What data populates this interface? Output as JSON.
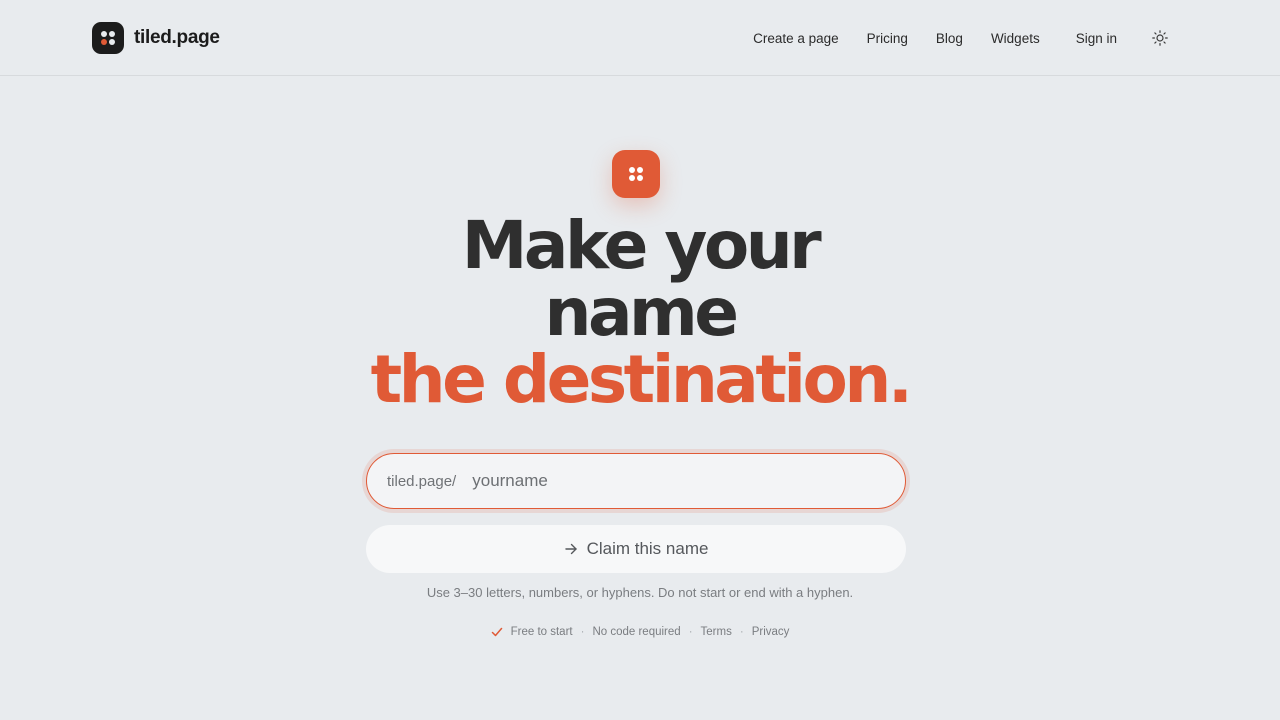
{
  "colors": {
    "background": "#e8ebee",
    "accent": "#e05a36",
    "text": "#2b2b2b"
  },
  "brand": {
    "name": "tiled.page",
    "logo_icon": "tiles-logo-icon"
  },
  "nav": {
    "items": [
      {
        "label": "Create a page"
      },
      {
        "label": "Pricing"
      },
      {
        "label": "Blog"
      },
      {
        "label": "Widgets"
      }
    ],
    "sign_in": "Sign in",
    "theme_icon": "sun-icon"
  },
  "hero": {
    "icon": "tiles-icon",
    "headline_line1": "Make your",
    "headline_line2": "name",
    "headline_accent": "the destination.",
    "url_prefix": "tiled.page/",
    "input_placeholder": "yourname",
    "input_value": "",
    "claim_button": "Claim this name",
    "claim_icon": "arrow-right-icon",
    "hint": "Use 3–30 letters, numbers, or hyphens. Do not start or end with a hyphen."
  },
  "footer": {
    "check_icon": "check-icon",
    "free": "Free to start",
    "no_code": "No code required",
    "terms": "Terms",
    "privacy": "Privacy",
    "separator": "·"
  }
}
